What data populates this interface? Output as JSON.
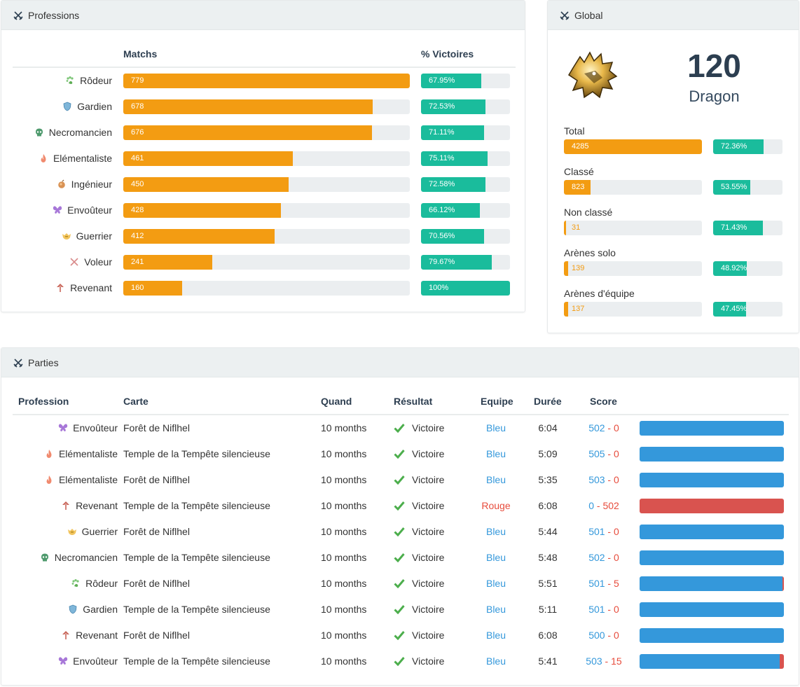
{
  "colors": {
    "orange": "#f39c12",
    "teal": "#1abc9c",
    "blue": "#3498db",
    "red": "#d9534f"
  },
  "professions_panel": {
    "title": "Professions",
    "col_matchs": "Matchs",
    "col_victoires": "% Victoires",
    "max_matchs": 779,
    "rows": [
      {
        "name": "Rôdeur",
        "icon": "paw-icon",
        "matchs": "779",
        "pct": "67.95%",
        "pct_val": 67.95
      },
      {
        "name": "Gardien",
        "icon": "shield-icon",
        "matchs": "678",
        "pct": "72.53%",
        "pct_val": 72.53
      },
      {
        "name": "Necromancien",
        "icon": "skull-icon",
        "matchs": "676",
        "pct": "71.11%",
        "pct_val": 71.11
      },
      {
        "name": "Elémentaliste",
        "icon": "flame-icon",
        "matchs": "461",
        "pct": "75.11%",
        "pct_val": 75.11
      },
      {
        "name": "Ingénieur",
        "icon": "gear-bomb-icon",
        "matchs": "450",
        "pct": "72.58%",
        "pct_val": 72.58
      },
      {
        "name": "Envoûteur",
        "icon": "butterfly-icon",
        "matchs": "428",
        "pct": "66.12%",
        "pct_val": 66.12
      },
      {
        "name": "Guerrier",
        "icon": "helmet-icon",
        "matchs": "412",
        "pct": "70.56%",
        "pct_val": 70.56
      },
      {
        "name": "Voleur",
        "icon": "crossed-daggers-icon",
        "matchs": "241",
        "pct": "79.67%",
        "pct_val": 79.67
      },
      {
        "name": "Revenant",
        "icon": "revenant-icon",
        "matchs": "160",
        "pct": "100%",
        "pct_val": 100
      }
    ]
  },
  "global_panel": {
    "title": "Global",
    "rank_number": "120",
    "rank_name": "Dragon",
    "stats": [
      {
        "label": "Total",
        "count": "4285",
        "count_frac": 1.0,
        "pct": "72.36%",
        "pct_val": 72.36
      },
      {
        "label": "Classé",
        "count": "823",
        "count_frac": 0.192,
        "pct": "53.55%",
        "pct_val": 53.55
      },
      {
        "label": "Non classé",
        "count": "31",
        "count_frac": 0.007,
        "pct": "71.43%",
        "pct_val": 71.43
      },
      {
        "label": "Arènes solo",
        "count": "139",
        "count_frac": 0.032,
        "pct": "48.92%",
        "pct_val": 48.92
      },
      {
        "label": "Arènes d'équipe",
        "count": "137",
        "count_frac": 0.032,
        "pct": "47.45%",
        "pct_val": 47.45
      }
    ]
  },
  "parties_panel": {
    "title": "Parties",
    "headers": {
      "profession": "Profession",
      "carte": "Carte",
      "quand": "Quand",
      "resultat": "Résultat",
      "equipe": "Equipe",
      "duree": "Durée",
      "score": "Score"
    },
    "rows": [
      {
        "profession": "Envoûteur",
        "icon": "butterfly-icon",
        "map": "Forêt de Niflhel",
        "when": "10 months",
        "result": "Victoire",
        "team": "Bleu",
        "team_color": "blue",
        "duration": "6:04",
        "score_blue": "502",
        "score_red": "0",
        "blue": 502,
        "red": 0
      },
      {
        "profession": "Elémentaliste",
        "icon": "flame-icon",
        "map": "Temple de la Tempête silencieuse",
        "when": "10 months",
        "result": "Victoire",
        "team": "Bleu",
        "team_color": "blue",
        "duration": "5:09",
        "score_blue": "505",
        "score_red": "0",
        "blue": 505,
        "red": 0
      },
      {
        "profession": "Elémentaliste",
        "icon": "flame-icon",
        "map": "Forêt de Niflhel",
        "when": "10 months",
        "result": "Victoire",
        "team": "Bleu",
        "team_color": "blue",
        "duration": "5:35",
        "score_blue": "503",
        "score_red": "0",
        "blue": 503,
        "red": 0
      },
      {
        "profession": "Revenant",
        "icon": "revenant-icon",
        "map": "Temple de la Tempête silencieuse",
        "when": "10 months",
        "result": "Victoire",
        "team": "Rouge",
        "team_color": "red",
        "duration": "6:08",
        "score_blue": "0",
        "score_red": "502",
        "blue": 0,
        "red": 502
      },
      {
        "profession": "Guerrier",
        "icon": "helmet-icon",
        "map": "Forêt de Niflhel",
        "when": "10 months",
        "result": "Victoire",
        "team": "Bleu",
        "team_color": "blue",
        "duration": "5:44",
        "score_blue": "501",
        "score_red": "0",
        "blue": 501,
        "red": 0
      },
      {
        "profession": "Necromancien",
        "icon": "skull-icon",
        "map": "Temple de la Tempête silencieuse",
        "when": "10 months",
        "result": "Victoire",
        "team": "Bleu",
        "team_color": "blue",
        "duration": "5:48",
        "score_blue": "502",
        "score_red": "0",
        "blue": 502,
        "red": 0
      },
      {
        "profession": "Rôdeur",
        "icon": "paw-icon",
        "map": "Forêt de Niflhel",
        "when": "10 months",
        "result": "Victoire",
        "team": "Bleu",
        "team_color": "blue",
        "duration": "5:51",
        "score_blue": "501",
        "score_red": "5",
        "blue": 501,
        "red": 5
      },
      {
        "profession": "Gardien",
        "icon": "shield-icon",
        "map": "Temple de la Tempête silencieuse",
        "when": "10 months",
        "result": "Victoire",
        "team": "Bleu",
        "team_color": "blue",
        "duration": "5:11",
        "score_blue": "501",
        "score_red": "0",
        "blue": 501,
        "red": 0
      },
      {
        "profession": "Revenant",
        "icon": "revenant-icon",
        "map": "Forêt de Niflhel",
        "when": "10 months",
        "result": "Victoire",
        "team": "Bleu",
        "team_color": "blue",
        "duration": "6:08",
        "score_blue": "500",
        "score_red": "0",
        "blue": 500,
        "red": 0
      },
      {
        "profession": "Envoûteur",
        "icon": "butterfly-icon",
        "map": "Temple de la Tempête silencieuse",
        "when": "10 months",
        "result": "Victoire",
        "team": "Bleu",
        "team_color": "blue",
        "duration": "5:41",
        "score_blue": "503",
        "score_red": "15",
        "blue": 503,
        "red": 15
      }
    ]
  }
}
